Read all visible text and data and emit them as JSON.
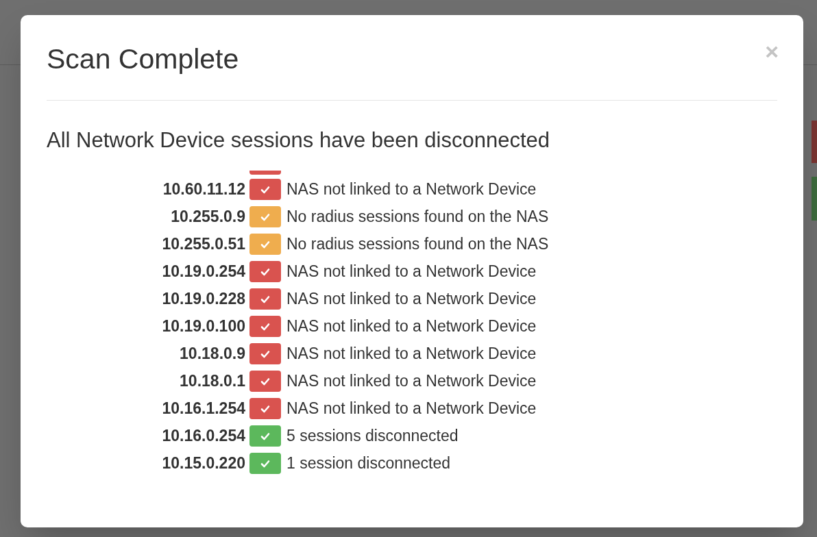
{
  "modal": {
    "title": "Scan Complete",
    "close": "×",
    "heading": "All Network Device sessions have been disconnected",
    "clipped_result": {
      "color": "#d9534f"
    },
    "results": [
      {
        "ip": "10.60.11.12",
        "color": "#d9534f",
        "message": "NAS not linked to a Network Device"
      },
      {
        "ip": "10.255.0.9",
        "color": "#efad4e",
        "message": "No radius sessions found on the NAS"
      },
      {
        "ip": "10.255.0.51",
        "color": "#efad4e",
        "message": "No radius sessions found on the NAS"
      },
      {
        "ip": "10.19.0.254",
        "color": "#d9534f",
        "message": "NAS not linked to a Network Device"
      },
      {
        "ip": "10.19.0.228",
        "color": "#d9534f",
        "message": "NAS not linked to a Network Device"
      },
      {
        "ip": "10.19.0.100",
        "color": "#d9534f",
        "message": "NAS not linked to a Network Device"
      },
      {
        "ip": "10.18.0.9",
        "color": "#d9534f",
        "message": "NAS not linked to a Network Device"
      },
      {
        "ip": "10.18.0.1",
        "color": "#d9534f",
        "message": "NAS not linked to a Network Device"
      },
      {
        "ip": "10.16.1.254",
        "color": "#d9534f",
        "message": "NAS not linked to a Network Device"
      },
      {
        "ip": "10.16.0.254",
        "color": "#5cb85c",
        "message": "5 sessions disconnected"
      },
      {
        "ip": "10.15.0.220",
        "color": "#5cb85c",
        "message": "1 session disconnected"
      }
    ]
  }
}
